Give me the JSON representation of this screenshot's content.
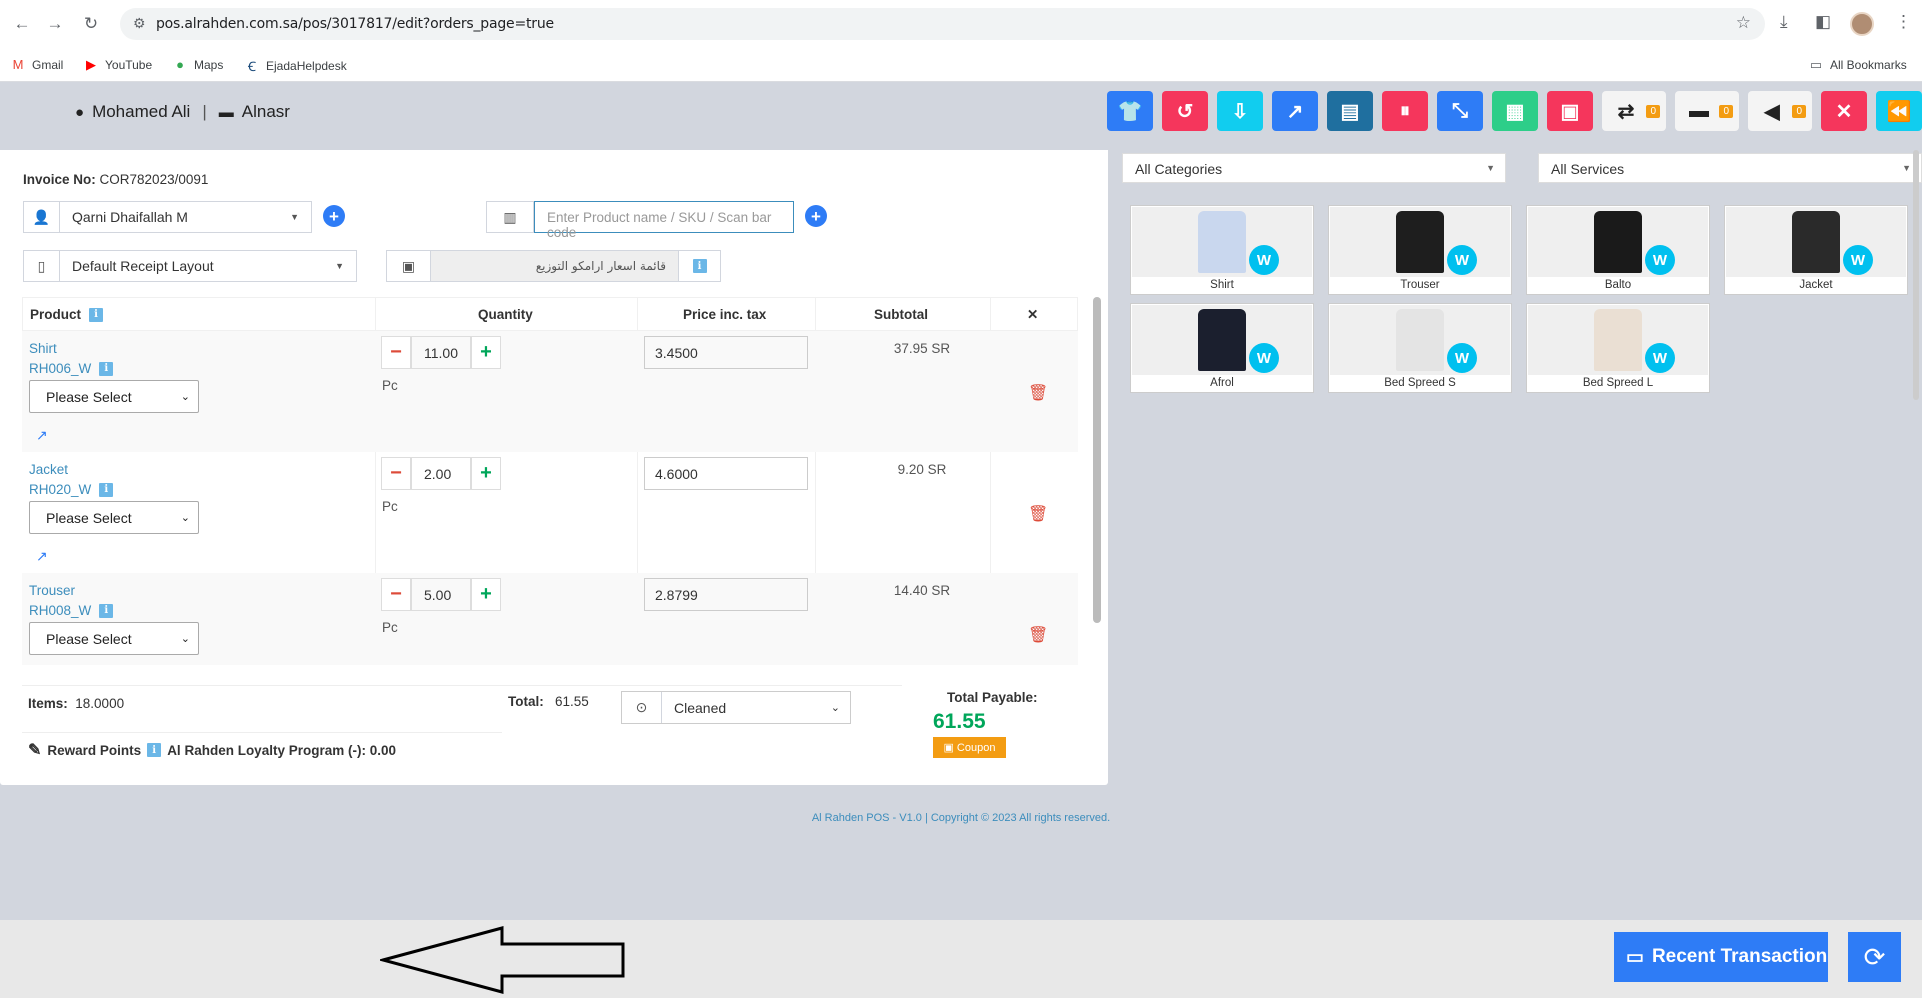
{
  "browser": {
    "url": "pos.alrahden.com.sa/pos/3017817/edit?orders_page=true",
    "bookmarks": [
      "Gmail",
      "YouTube",
      "Maps",
      "EjadaHelpdesk"
    ],
    "all_bookmarks": "All Bookmarks"
  },
  "header": {
    "user_name": "Mohamed Ali",
    "separator": "|",
    "location": "Alnasr",
    "toolbar": [
      {
        "icon": "shirt-icon",
        "color": "#2e7cf6",
        "glyph": "👕"
      },
      {
        "icon": "undo-icon",
        "color": "#f5365c",
        "glyph": "↺"
      },
      {
        "icon": "hand-money-icon",
        "color": "#11cdef",
        "glyph": "⇩"
      },
      {
        "icon": "external-link-icon",
        "color": "#2e7cf6",
        "glyph": "↗"
      },
      {
        "icon": "warehouse-icon",
        "color": "#1f6f9f",
        "glyph": "▤"
      },
      {
        "icon": "pause-icon",
        "color": "#f5365c",
        "glyph": "⏸"
      },
      {
        "icon": "compress-icon",
        "color": "#2e7cf6",
        "glyph": "⤡"
      },
      {
        "icon": "calculator-icon",
        "color": "#2dce89",
        "glyph": "▦"
      },
      {
        "icon": "cash-register-icon",
        "color": "#f5365c",
        "glyph": "▣"
      }
    ],
    "badged_buttons": [
      {
        "icon": "exchange-icon",
        "glyph": "⇄",
        "count": "0"
      },
      {
        "icon": "comment-icon",
        "glyph": "▬",
        "count": "0"
      },
      {
        "icon": "bullhorn-icon",
        "glyph": "◀",
        "count": "0"
      }
    ],
    "close_glyph": "✕",
    "back_glyph": "⏪"
  },
  "invoice": {
    "label": "Invoice No:",
    "number": "COR782023/0091",
    "customer": "Qarni Dhaifallah M",
    "search_placeholder": "Enter Product name / SKU / Scan bar code",
    "receipt_layout": "Default Receipt Layout",
    "price_list": "قائمة اسعار ارامكو التوزيع"
  },
  "table": {
    "headers": [
      "Product",
      "Quantity",
      "Price inc. tax",
      "Subtotal",
      "✕"
    ],
    "rows": [
      {
        "name": "Shirt",
        "sku": "RH006_W",
        "select": "Please Select",
        "qty": "11.00",
        "unit": "Pc",
        "price": "3.4500",
        "subtotal": "37.95 SR"
      },
      {
        "name": "Jacket",
        "sku": "RH020_W",
        "select": "Please Select",
        "qty": "2.00",
        "unit": "Pc",
        "price": "4.6000",
        "subtotal": "9.20 SR"
      },
      {
        "name": "Trouser",
        "sku": "RH008_W",
        "select": "Please Select",
        "qty": "5.00",
        "unit": "Pc",
        "price": "2.8799",
        "subtotal": "14.40 SR"
      }
    ]
  },
  "summary": {
    "items_label": "Items:",
    "items_value": "18.0000",
    "total_label": "Total:",
    "total_value": "61.55",
    "status": "Cleaned",
    "total_payable_label": "Total Payable:",
    "total_payable": "61.55",
    "coupon": "Coupon",
    "reward_label": "Reward Points",
    "loyalty": "Al Rahden Loyalty Program (-): 0.00"
  },
  "filters": {
    "categories": "All Categories",
    "services": "All Services"
  },
  "products": [
    {
      "name": "Shirt",
      "badge": "W"
    },
    {
      "name": "Trouser",
      "badge": "W"
    },
    {
      "name": "Balto",
      "badge": "W"
    },
    {
      "name": "Jacket",
      "badge": "W"
    },
    {
      "name": "Afrol",
      "badge": "W"
    },
    {
      "name": "Bed Spreed S",
      "badge": "W"
    },
    {
      "name": "Bed Spreed L",
      "badge": "W"
    }
  ],
  "footer": {
    "copyright": "Al Rahden POS - V1.0 | Copyright © 2023 All rights reserved.",
    "recent_transactions": "Recent Transactions"
  }
}
